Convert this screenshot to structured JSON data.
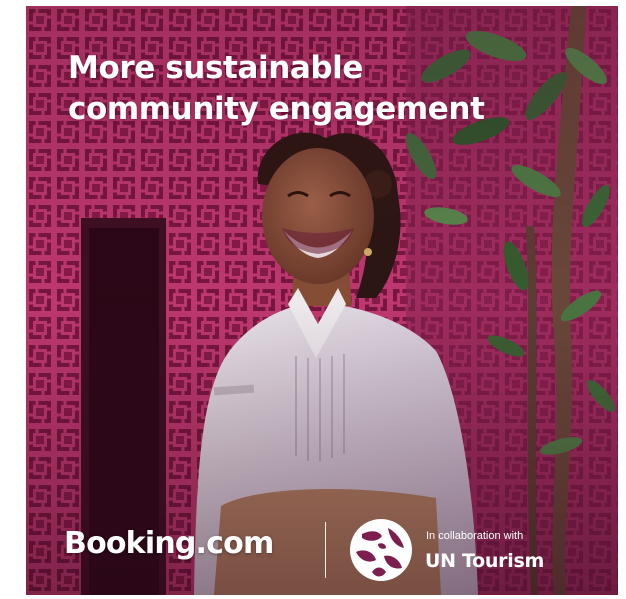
{
  "headline": {
    "line1": "More sustainable",
    "line2": "community engagement"
  },
  "footer": {
    "brand": "Booking.com",
    "collaboration_caption": "In collaboration with",
    "partner_name": "UN Tourism"
  },
  "colors": {
    "wall_pink": "#c2376f",
    "wall_dark": "#6a1238",
    "shirt_white": "#ece8f0",
    "skirt_tan": "#b98a66",
    "text_white": "#ffffff"
  },
  "icons": [
    "un-tourism-logo-icon"
  ]
}
